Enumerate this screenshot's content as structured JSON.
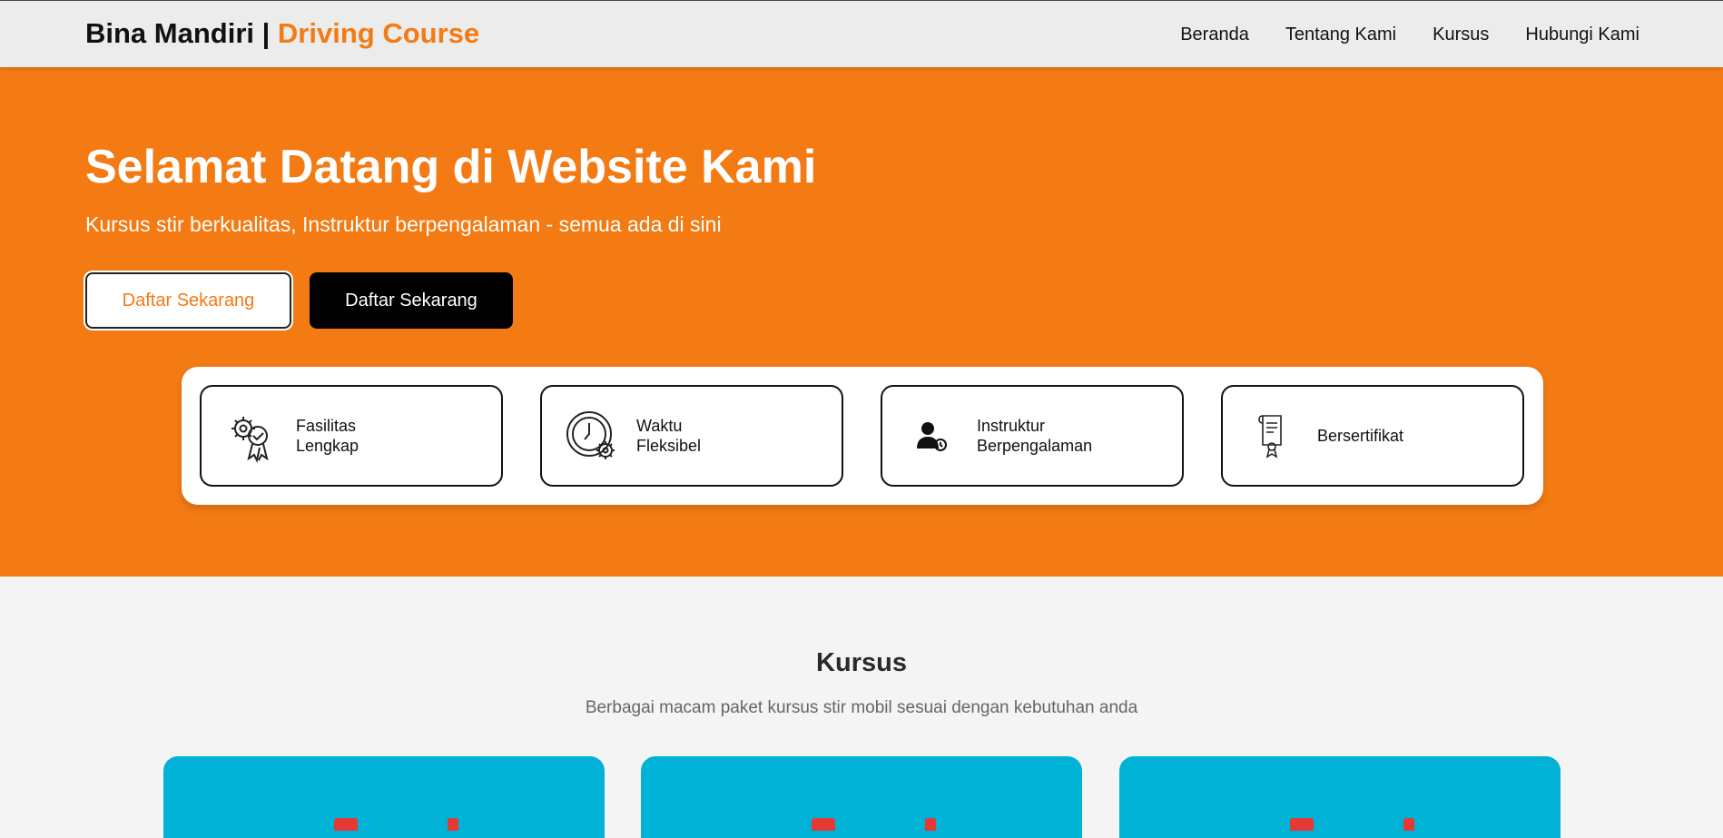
{
  "header": {
    "brand_main": "Bina Mandiri | ",
    "brand_accent": "Driving Course",
    "nav": [
      "Beranda",
      "Tentang Kami",
      "Kursus",
      "Hubungi Kami"
    ]
  },
  "hero": {
    "title": "Selamat Datang di Website Kami",
    "subtitle": "Kursus stir berkualitas, Instruktur berpengalaman - semua ada di sini",
    "primary_button": "Daftar Sekarang",
    "secondary_button": "Daftar Sekarang"
  },
  "features": [
    {
      "line1": "Fasilitas",
      "line2": "Lengkap",
      "icon": "gear-badge-icon"
    },
    {
      "line1": "Waktu",
      "line2": "Fleksibel",
      "icon": "clock-gear-icon"
    },
    {
      "line1": "Instruktur",
      "line2": "Berpengalaman",
      "icon": "instructor-icon"
    },
    {
      "line1": "Bersertifikat",
      "line2": "",
      "icon": "certificate-icon"
    }
  ],
  "courses": {
    "title": "Kursus",
    "subtitle": "Berbagai macam paket kursus stir mobil sesuai dengan kebutuhan anda"
  },
  "colors": {
    "accent": "#f47a14",
    "card": "#00b2d6",
    "header_bg": "#ececec"
  }
}
